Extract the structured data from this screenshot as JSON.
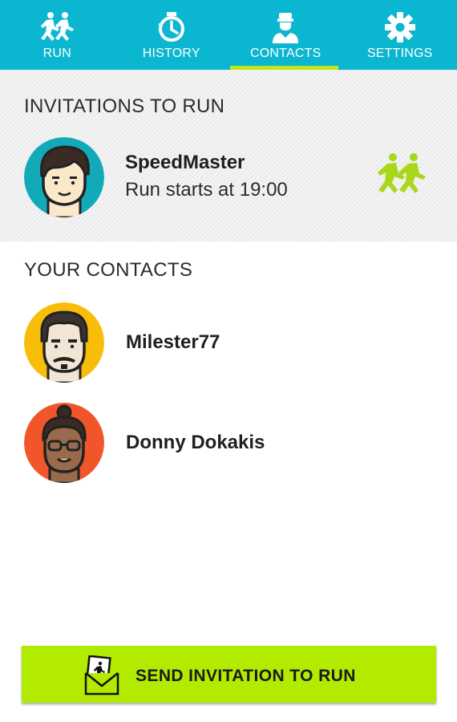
{
  "nav": {
    "tabs": [
      {
        "label": "RUN",
        "icon": "runners-icon",
        "active": false
      },
      {
        "label": "HISTORY",
        "icon": "stopwatch-icon",
        "active": false
      },
      {
        "label": "CONTACTS",
        "icon": "person-icon",
        "active": true
      },
      {
        "label": "SETTINGS",
        "icon": "gear-icon",
        "active": false
      }
    ]
  },
  "invitations": {
    "title": "INVITATIONS TO RUN",
    "items": [
      {
        "name": "SpeedMaster",
        "subtitle": "Run starts at 19:00",
        "action_icon": "runners-icon"
      }
    ]
  },
  "contacts": {
    "title": "YOUR CONTACTS",
    "items": [
      {
        "name": "Milester77"
      },
      {
        "name": "Donny Dokakis"
      }
    ]
  },
  "send_button": {
    "label": "SEND INVITATION TO RUN",
    "icon": "envelope-runner-icon"
  },
  "colors": {
    "primary": "#0bb7d0",
    "accent": "#b2ea00",
    "indicator": "#bfe81a",
    "avatar_teal": "#12aab8",
    "avatar_yellow": "#f8bd09",
    "avatar_orange": "#f1562a"
  }
}
